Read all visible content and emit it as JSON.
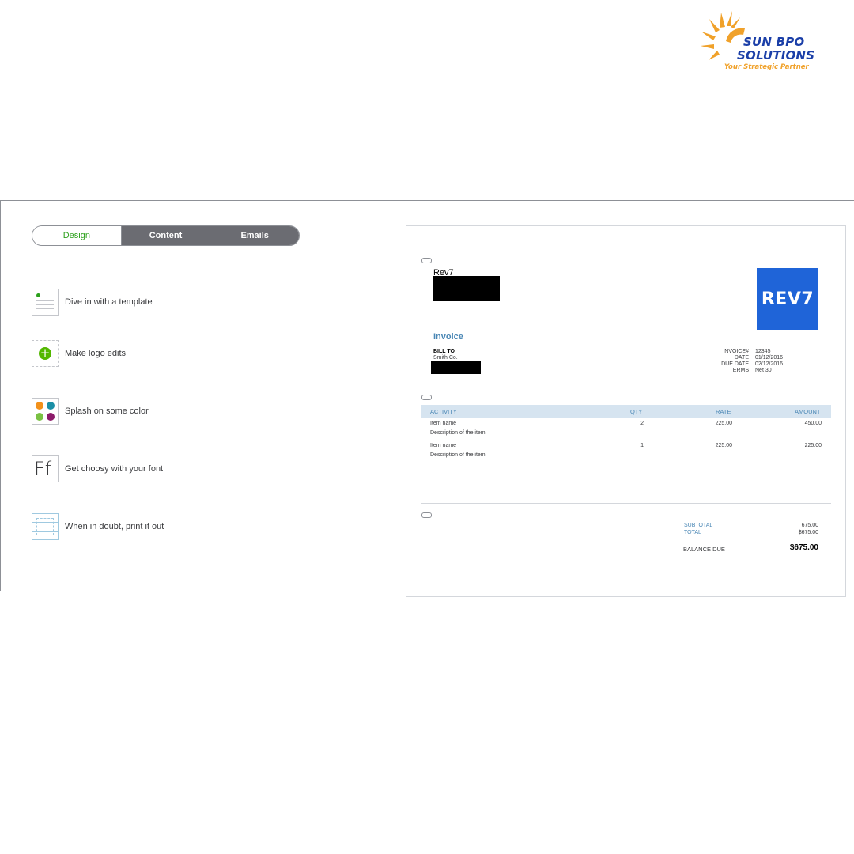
{
  "brand": {
    "name_line1": "SUN BPO",
    "name_line2": "SOLUTIONS",
    "tagline": "Your Strategic Partner",
    "sun_color": "#f0a12a",
    "text_color": "#1b3fa8"
  },
  "tabs": [
    {
      "label": "Design",
      "active": true
    },
    {
      "label": "Content",
      "active": false
    },
    {
      "label": "Emails",
      "active": false
    }
  ],
  "options": [
    {
      "label": "Dive in with a template",
      "icon": "template-icon"
    },
    {
      "label": "Make logo edits",
      "icon": "add-logo-icon"
    },
    {
      "label": "Splash on some color",
      "icon": "color-palette-icon"
    },
    {
      "label": "Get choosy with your font",
      "icon": "font-icon"
    },
    {
      "label": "When in doubt, print it out",
      "icon": "print-layout-icon"
    }
  ],
  "invoice": {
    "company_name": "Rev7",
    "logo_text": "REV7",
    "title": "Invoice",
    "bill_to_label": "BILL TO",
    "bill_to_name": "Smith Co.",
    "meta": [
      {
        "label": "INVOICE#",
        "value": "12345"
      },
      {
        "label": "DATE",
        "value": "01/12/2016"
      },
      {
        "label": "DUE DATE",
        "value": "02/12/2016"
      },
      {
        "label": "TERMS",
        "value": "Net 30"
      }
    ],
    "columns": {
      "activity": "ACTIVITY",
      "qty": "QTY",
      "rate": "RATE",
      "amount": "AMOUNT"
    },
    "lines": [
      {
        "name": "Item name",
        "description": "Description of the item",
        "qty": "2",
        "rate": "225.00",
        "amount": "450.00"
      },
      {
        "name": "Item name",
        "description": "Description of the item",
        "qty": "1",
        "rate": "225.00",
        "amount": "225.00"
      }
    ],
    "subtotal_label": "SUBTOTAL",
    "subtotal_value": "675.00",
    "total_label": "TOTAL",
    "total_value": "$675.00",
    "balance_label": "BALANCE DUE",
    "balance_value": "$675.00",
    "accent_color": "#4a87b5",
    "logo_color": "#1f64d8"
  }
}
